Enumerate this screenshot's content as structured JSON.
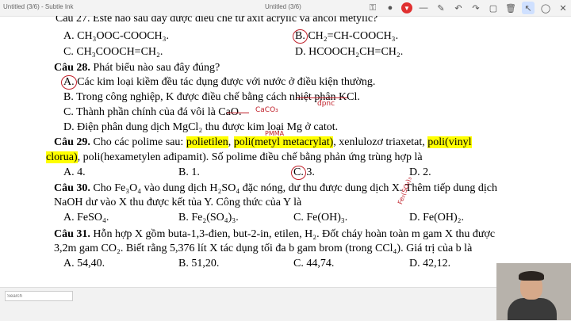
{
  "window": {
    "app_title": "Untitled (3/6) - Subtle Ink",
    "doc_title": "Untitled (3/6)"
  },
  "toolbar": {
    "icons": [
      "lock-icon",
      "record-icon",
      "minimize-icon",
      "pen-icon",
      "undo-icon",
      "redo-icon",
      "square-icon",
      "trash-icon",
      "arrow-icon",
      "circle-icon",
      "cross-icon"
    ]
  },
  "q27": {
    "stem": "Câu 27. Este nào sau đây được điều chế từ axit acrylic và ancol metylic?",
    "a": "A. CH₃OOC-COOCH₃.",
    "b_letter": "B.",
    "b": " CH₂=CH-COOCH₃.",
    "c": "C. CH₃COOCH=CH₂.",
    "d": "D. HCOOCH₂CH=CH₂."
  },
  "q28": {
    "num": "Câu 28.",
    "stem": " Phát biểu nào sau đây đúng?",
    "a_letter": "A.",
    "a": " Các kim loại kiềm đều tác dụng được với nước ở điều kiện thường.",
    "b": "B. Trong công nghiệp, K được điều chế bằng cách nhiệt phân KCl.",
    "c": "C. Thành phần chính của đá vôi là CaO.",
    "d": "D. Điện phân dung dịch MgCl₂ thu được kim loại Mg ở catot.",
    "ann_caco3": "CaCO₃",
    "ann_dpnc": "đpnc"
  },
  "q29": {
    "num": "Câu 29.",
    "pre": " Cho các polime sau: ",
    "p1": "polietilen",
    "sep1": ", ",
    "p2": "poli(metyl metacrylat)",
    "mid": ", xenlulozơ triaxetat, ",
    "p3": "poli(vinyl",
    "p3b": "clorua)",
    "rest": ", poli(hexametylen ađipamit). Số polime điều chế bằng phản ứng trùng hợp là",
    "ann_pmma": "PMMA",
    "a": "A. 4.",
    "b": "B. 1.",
    "c_letter": "C.",
    "c": " 3.",
    "d": "D. 2."
  },
  "q30": {
    "num": "Câu 30.",
    "stem1": " Cho Fe₃O₄ vào dung dịch H₂SO₄ đặc nóng, dư thu được dung dịch X. Thêm tiếp dung dịch",
    "stem2": "NaOH dư vào X thu được kết tủa Y. Công thức của Y là",
    "ann_fe": "Fe₂(SO₄)₃",
    "a": "A. FeSO₄.",
    "b": "B. Fe₂(SO₄)₃.",
    "c": "C. Fe(OH)₃.",
    "d": "D. Fe(OH)₂."
  },
  "q31": {
    "num": "Câu 31.",
    "stem1": " Hỗn hợp X gồm buta-1,3-đien, but-2-in, etilen, H₂. Đốt cháy hoàn toàn m gam X thu được",
    "stem2": "3,2m gam CO₂. Biết rằng 5,376 lít X tác dụng tối đa b gam brom (trong CCl₄). Giá trị của b là",
    "a": "A. 54,40.",
    "b": "B. 51,20.",
    "c": "C. 44,74.",
    "d": "D. 42,12."
  },
  "taskbar": {
    "search_placeholder": "Search"
  },
  "colors": {
    "highlight": "#ffff00",
    "ink": "#c0202a"
  }
}
